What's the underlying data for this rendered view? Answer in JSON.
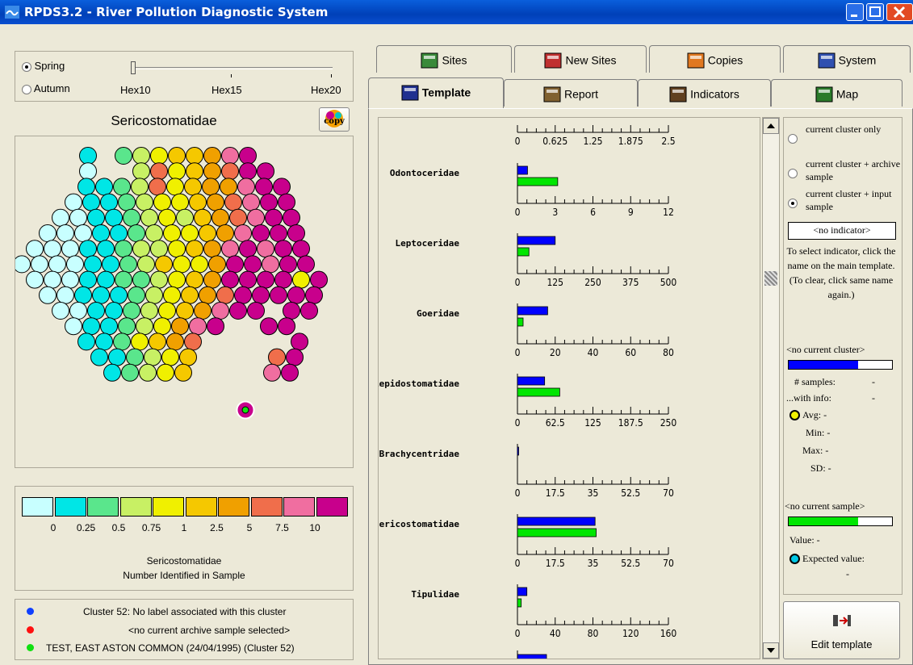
{
  "window": {
    "title": "RPDS3.2 - River Pollution Diagnostic System"
  },
  "season": {
    "spring": "Spring",
    "autumn": "Autumn",
    "selected": "spring"
  },
  "hex_slider": {
    "ticks": [
      "Hex10",
      "Hex15",
      "Hex20"
    ]
  },
  "map": {
    "title": "Sericostomatidae",
    "copy_label": "copy"
  },
  "legend": {
    "colors": [
      "#c8ffff",
      "#00e6e6",
      "#5ae68c",
      "#c8f064",
      "#f0f000",
      "#f5c800",
      "#f0a000",
      "#f06e4b",
      "#f06ea0",
      "#c8008c"
    ],
    "labels": [
      "0",
      "0.25",
      "0.5",
      "0.75",
      "1",
      "2.5",
      "5",
      "7.5",
      "10"
    ],
    "title": "Sericostomatidae",
    "subtitle": "Number Identified in Sample"
  },
  "status": {
    "cluster": "Cluster 52: No label associated with this cluster",
    "archive": "<no current archive sample selected>",
    "input": "TEST, EAST ASTON COMMON (24/04/1995) (Cluster 52)"
  },
  "tabs_top": [
    {
      "label": "Sites",
      "icon": "sites-icon"
    },
    {
      "label": "New Sites",
      "icon": "new-sites-icon"
    },
    {
      "label": "Copies",
      "icon": "copies-icon"
    },
    {
      "label": "System",
      "icon": "system-icon"
    }
  ],
  "tabs_bottom": [
    {
      "label": "Template",
      "icon": "template-icon",
      "active": true
    },
    {
      "label": "Report",
      "icon": "report-icon"
    },
    {
      "label": "Indicators",
      "icon": "indicators-icon"
    },
    {
      "label": "Map",
      "icon": "map-icon"
    }
  ],
  "chart_data": {
    "type": "bar",
    "series_colors": {
      "cluster": "#0000ff",
      "input": "#00e600"
    },
    "first_axis_ticks": [
      "0",
      "0.625",
      "1.25",
      "1.875",
      "2.5"
    ],
    "taxa": [
      {
        "name": "Odontoceridae",
        "ticks": [
          "0",
          "3",
          "6",
          "9",
          "12"
        ],
        "max": 12,
        "cluster": 0.8,
        "input": 3.2
      },
      {
        "name": "Leptoceridae",
        "ticks": [
          "0",
          "125",
          "250",
          "375",
          "500"
        ],
        "max": 500,
        "cluster": 125,
        "input": 38
      },
      {
        "name": "Goeridae",
        "ticks": [
          "0",
          "20",
          "40",
          "60",
          "80"
        ],
        "max": 80,
        "cluster": 16,
        "input": 3
      },
      {
        "name": "Lepidostomatidae",
        "ticks": [
          "0",
          "62.5",
          "125",
          "187.5",
          "250"
        ],
        "max": 250,
        "cluster": 45,
        "input": 70
      },
      {
        "name": "Brachycentridae",
        "ticks": [
          "0",
          "17.5",
          "35",
          "52.5",
          "70"
        ],
        "max": 70,
        "cluster": 0.5,
        "input": 0
      },
      {
        "name": "Sericostomatidae",
        "ticks": [
          "0",
          "17.5",
          "35",
          "52.5",
          "70"
        ],
        "max": 70,
        "cluster": 36,
        "input": 36.5
      },
      {
        "name": "Tipulidae",
        "ticks": [
          "0",
          "40",
          "80",
          "120",
          "160"
        ],
        "max": 160,
        "cluster": 10,
        "input": 4
      }
    ]
  },
  "right_panel": {
    "options": [
      {
        "label": "current cluster only",
        "selected": false
      },
      {
        "label": "current cluster + archive sample",
        "selected": false
      },
      {
        "label": "current cluster + input sample",
        "selected": true
      }
    ],
    "indicator_box": "<no indicator>",
    "hint": "To select indicator, click the name on the main template. (To clear, click same name again.)",
    "no_cluster": "<no current cluster>",
    "samples_label": "# samples:",
    "samples_value": "-",
    "with_info_label": "...with info:",
    "with_info_value": "-",
    "avg": "Avg: -",
    "min": "Min: -",
    "max": "Max: -",
    "sd": "SD: -",
    "no_sample": "<no current sample>",
    "value": "Value: -",
    "expected": "Expected value:",
    "expected_value": "-",
    "edit_button": "Edit template"
  }
}
